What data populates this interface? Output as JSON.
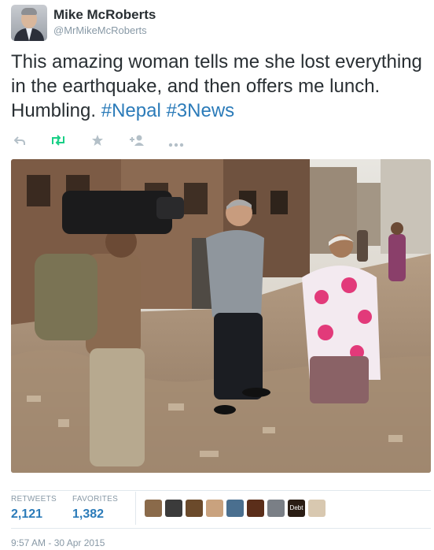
{
  "author": {
    "name": "Mike McRoberts",
    "handle": "@MrMikeMcRoberts"
  },
  "tweet": {
    "text": "This amazing woman tells me she lost everything in the earthquake, and then offers me lunch. Humbling.",
    "hashtags": [
      "#Nepal",
      "#3News"
    ]
  },
  "actions": [
    {
      "name": "reply",
      "icon": "reply-icon",
      "glyph": "↰"
    },
    {
      "name": "retweet",
      "icon": "retweet-icon",
      "glyph": "⇄"
    },
    {
      "name": "favorite",
      "icon": "star-icon",
      "glyph": "★"
    },
    {
      "name": "follow",
      "icon": "follow-icon",
      "glyph": "+👤"
    },
    {
      "name": "more",
      "icon": "more-icon",
      "glyph": "•••"
    }
  ],
  "stats": {
    "retweets_label": "RETWEETS",
    "retweets_value": "2,121",
    "favorites_label": "FAVORITES",
    "favorites_value": "1,382"
  },
  "favoriters": [
    {
      "color": "#8a6a4a"
    },
    {
      "color": "#3b3b3b"
    },
    {
      "color": "#6b4a2b"
    },
    {
      "color": "#c9a27e"
    },
    {
      "color": "#4a6f8f"
    },
    {
      "color": "#5b2e1a"
    },
    {
      "color": "#7a7f86"
    },
    {
      "color": "#2a1d14",
      "label": "Debt"
    },
    {
      "color": "#d8c8b0"
    }
  ],
  "timestamp": "9:57 AM - 30 Apr 2015",
  "colors": {
    "link": "#2b7bb9",
    "muted": "#8899a6",
    "retweet_green": "#19cf86"
  }
}
